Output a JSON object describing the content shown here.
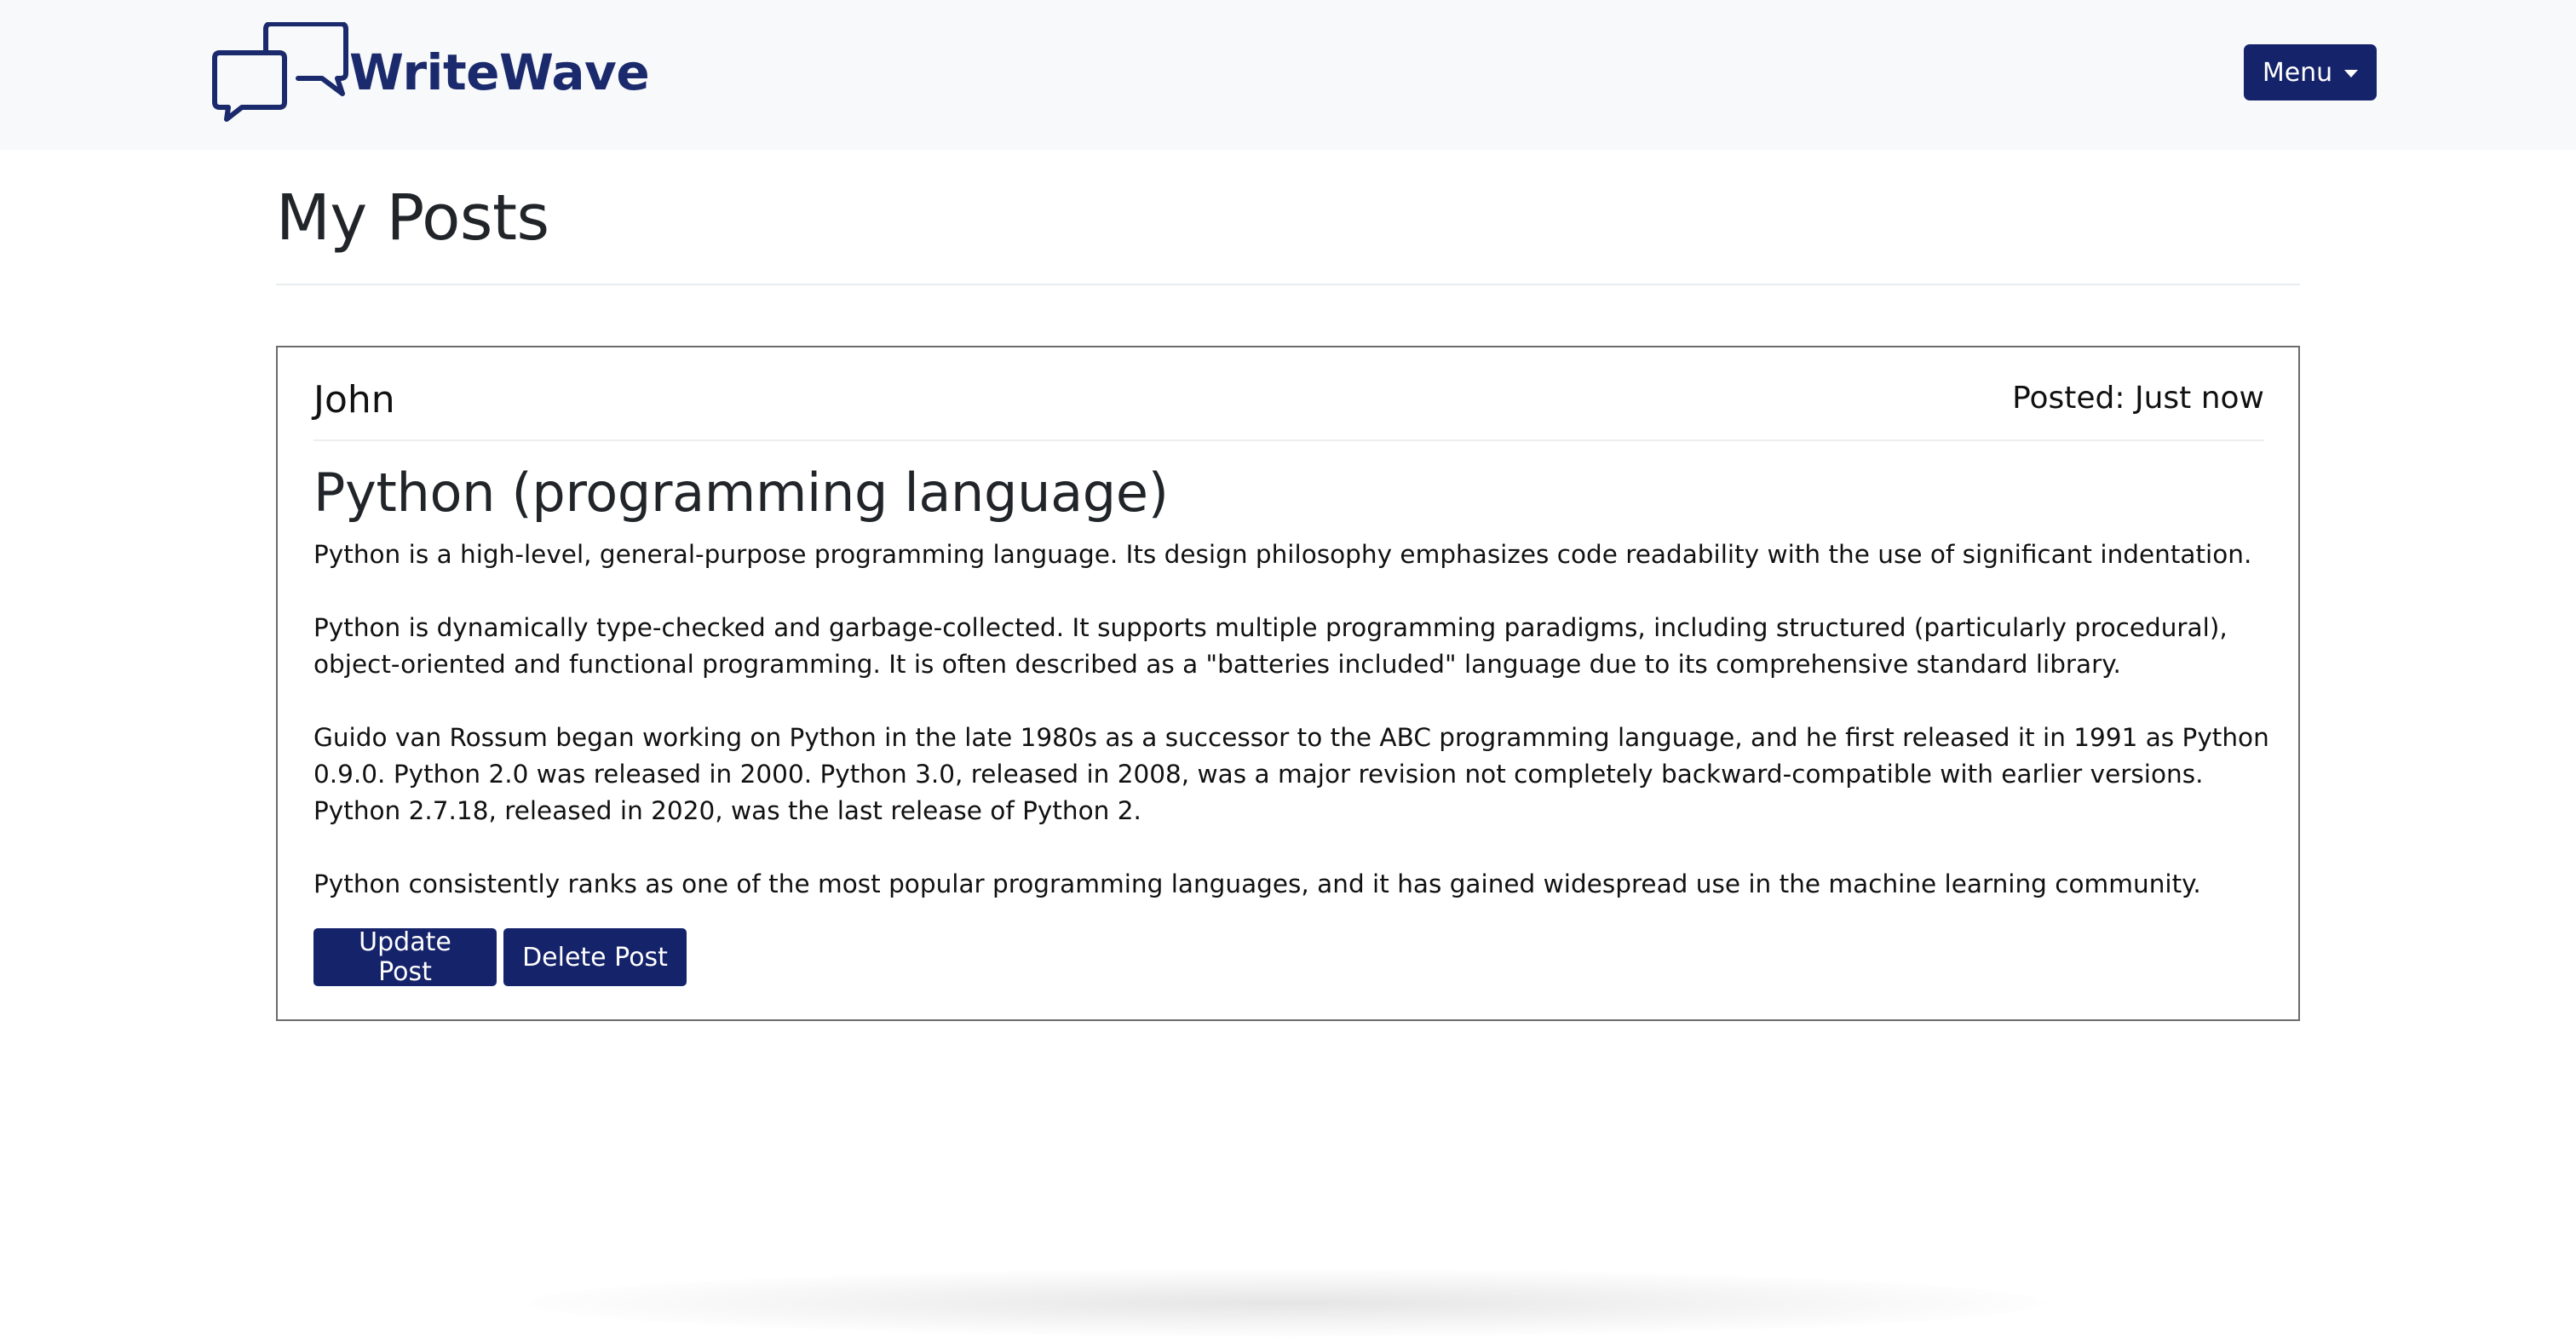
{
  "navbar": {
    "brand_name": "WriteWave",
    "logo_icon": "chat-bubbles-icon",
    "menu_label": "Menu",
    "brand_color": "#1a2a6c",
    "background": "#f8f9fa"
  },
  "page": {
    "title": "My Posts"
  },
  "post": {
    "author": "John",
    "posted": "Posted: Just now",
    "title": "Python (programming language)",
    "paragraphs": [
      "Python is a high-level, general-purpose programming language. Its design philosophy emphasizes code readability with the use of significant indentation.",
      "Python is dynamically type-checked and garbage-collected. It supports multiple programming paradigms, including structured (particularly procedural), object-oriented and functional programming. It is often described as a \"batteries included\" language due to its comprehensive standard library.",
      "Guido van Rossum began working on Python in the late 1980s as a successor to the ABC programming language, and he first released it in 1991 as Python 0.9.0. Python 2.0 was released in 2000. Python 3.0, released in 2008, was a major revision not completely backward-compatible with earlier versions. Python 2.7.18, released in 2020, was the last release of Python 2.",
      "Python consistently ranks as one of the most popular programming languages, and it has gained widespread use in the machine learning community."
    ],
    "update_label": "Update Post",
    "delete_label": "Delete Post"
  },
  "colors": {
    "primary_button": "#15236b",
    "card_border": "#6c6c6c"
  }
}
